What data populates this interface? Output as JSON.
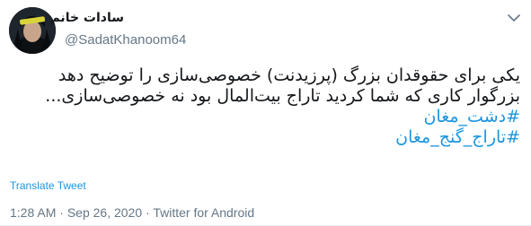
{
  "author": {
    "display_name": "سادات خانم",
    "handle": "@SadatKhanoom64"
  },
  "tweet": {
    "lines": [
      "یکی برای حقوقدان بزرگ (پرزیدنت) خصوصی‌سازی را توضیح دهد",
      "بزرگوار کاری که شما کردید تاراج بیت‌المال بود نه خصوصی‌سازی..."
    ],
    "hashtags": [
      "#دشت_مغان",
      "#تاراج_گنج_مغان"
    ]
  },
  "translate_label": "Translate Tweet",
  "meta": {
    "time": "1:28 AM",
    "separator": "·",
    "date": "Sep 26, 2020",
    "source": "Twitter for Android"
  },
  "colors": {
    "link": "#1b95e0",
    "secondary_text": "#657786",
    "primary_text": "#14171a"
  },
  "icons": [
    "avatar",
    "chevron-down-icon"
  ]
}
